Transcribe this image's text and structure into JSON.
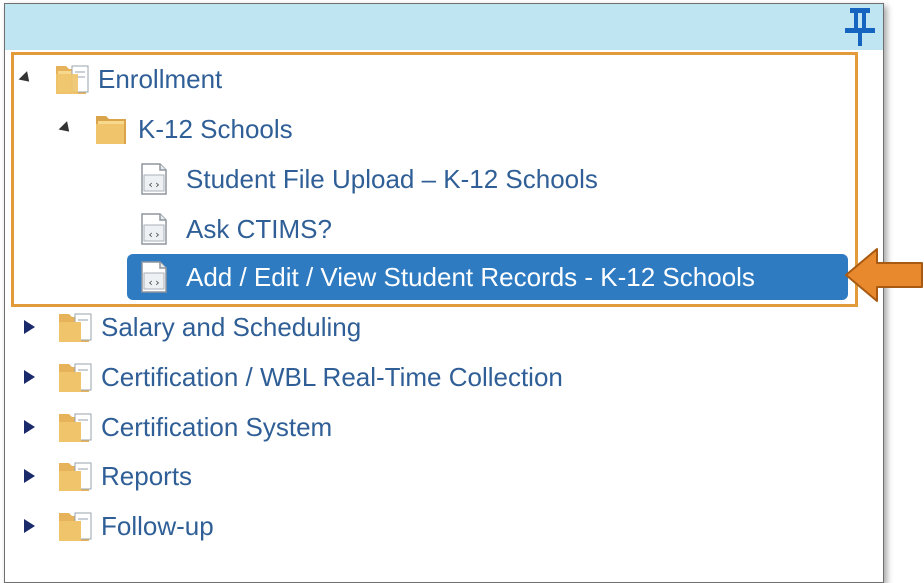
{
  "colors": {
    "header_bg": "#bfe4f2",
    "pin": "#1565c0",
    "link_text": "#2f5f96",
    "selected_bg": "#2e7bc2",
    "highlight_border": "#e39a3b",
    "callout_arrow": "#e8892e"
  },
  "header": {
    "pin_icon": "pin-icon"
  },
  "tree": {
    "enrollment": {
      "label": "Enrollment",
      "k12": {
        "label": "K-12 Schools",
        "items": [
          "Student File Upload – K-12 Schools",
          "Ask CTIMS?",
          "Add / Edit / View Student Records - K-12 Schools"
        ]
      }
    },
    "collapsed": [
      "Salary and Scheduling",
      "Certification / WBL Real-Time Collection",
      "Certification System",
      "Reports",
      "Follow-up"
    ]
  }
}
